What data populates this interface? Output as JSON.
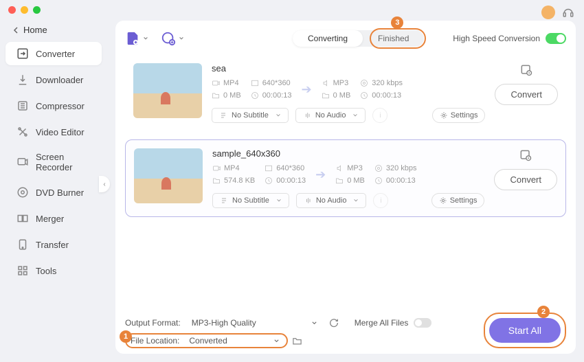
{
  "sidebar": {
    "home": "Home",
    "items": [
      {
        "label": "Converter"
      },
      {
        "label": "Downloader"
      },
      {
        "label": "Compressor"
      },
      {
        "label": "Video Editor"
      },
      {
        "label": "Screen Recorder"
      },
      {
        "label": "DVD Burner"
      },
      {
        "label": "Merger"
      },
      {
        "label": "Transfer"
      },
      {
        "label": "Tools"
      }
    ]
  },
  "tabs": {
    "converting": "Converting",
    "finished": "Finished"
  },
  "speed_label": "High Speed Conversion",
  "items": [
    {
      "title": "sea",
      "src": {
        "format": "MP4",
        "res": "640*360",
        "size": "0 MB",
        "dur": "00:00:13"
      },
      "dst": {
        "format": "MP3",
        "bitrate": "320 kbps",
        "size": "0 MB",
        "dur": "00:00:13"
      },
      "subtitle": "No Subtitle",
      "audio": "No Audio",
      "settings": "Settings",
      "action": "Convert"
    },
    {
      "title": "sample_640x360",
      "src": {
        "format": "MP4",
        "res": "640*360",
        "size": "574.8 KB",
        "dur": "00:00:13"
      },
      "dst": {
        "format": "MP3",
        "bitrate": "320 kbps",
        "size": "0 MB",
        "dur": "00:00:13"
      },
      "subtitle": "No Subtitle",
      "audio": "No Audio",
      "settings": "Settings",
      "action": "Convert"
    }
  ],
  "bottom": {
    "output_label": "Output Format:",
    "output_value": "MP3-High Quality",
    "merge_label": "Merge All Files",
    "loc_label": "File Location:",
    "loc_value": "Converted",
    "start": "Start All"
  },
  "badges": {
    "b1": "1",
    "b2": "2",
    "b3": "3"
  }
}
